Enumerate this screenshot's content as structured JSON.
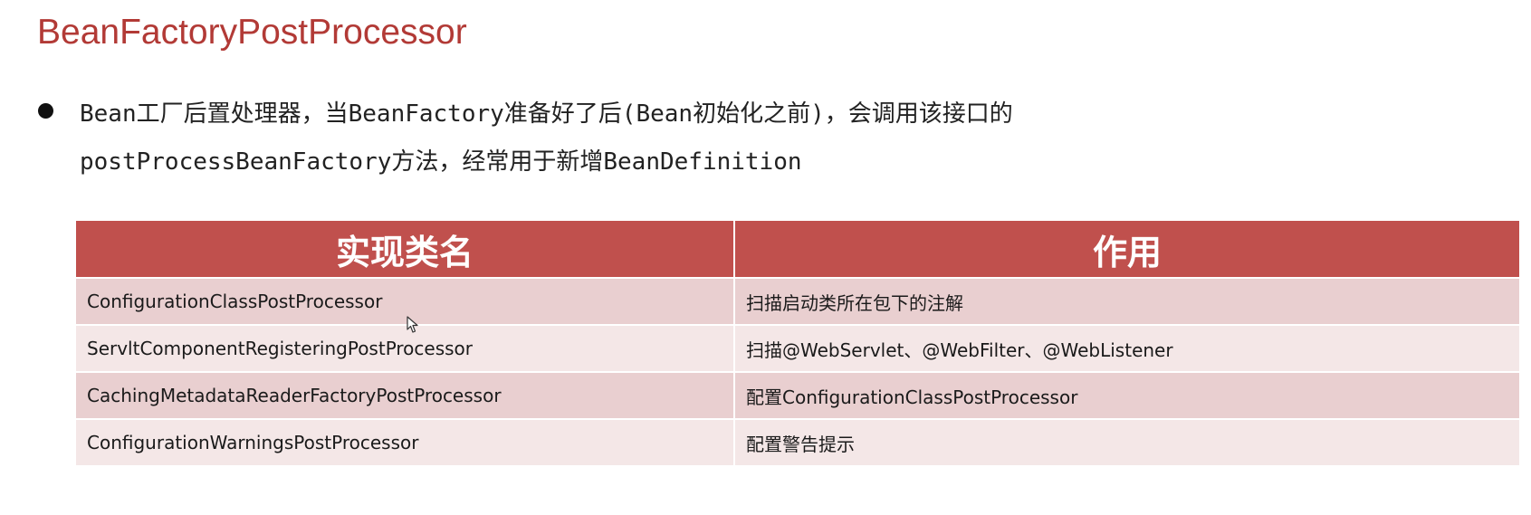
{
  "title": "BeanFactoryPostProcessor",
  "bullet": {
    "line1": "Bean工厂后置处理器，当BeanFactory准备好了后(Bean初始化之前)，会调用该接口的",
    "line2": "postProcessBeanFactory方法，经常用于新增BeanDefinition"
  },
  "table": {
    "headers": [
      "实现类名",
      "作用"
    ],
    "rows": [
      [
        "ConfigurationClassPostProcessor",
        "扫描启动类所在包下的注解"
      ],
      [
        "ServltComponentRegisteringPostProcessor",
        "扫描@WebServlet、@WebFilter、@WebListener"
      ],
      [
        "CachingMetadataReaderFactoryPostProcessor",
        "配置ConfigurationClassPostProcessor"
      ],
      [
        "ConfigurationWarningsPostProcessor",
        "配置警告提示"
      ]
    ]
  },
  "colors": {
    "title": "#b23a36",
    "header_bg": "#c0504d",
    "row_odd": "#e9cfd0",
    "row_even": "#f4e7e7"
  },
  "icons": [
    "bullet-dot-icon",
    "mouse-cursor-icon"
  ]
}
